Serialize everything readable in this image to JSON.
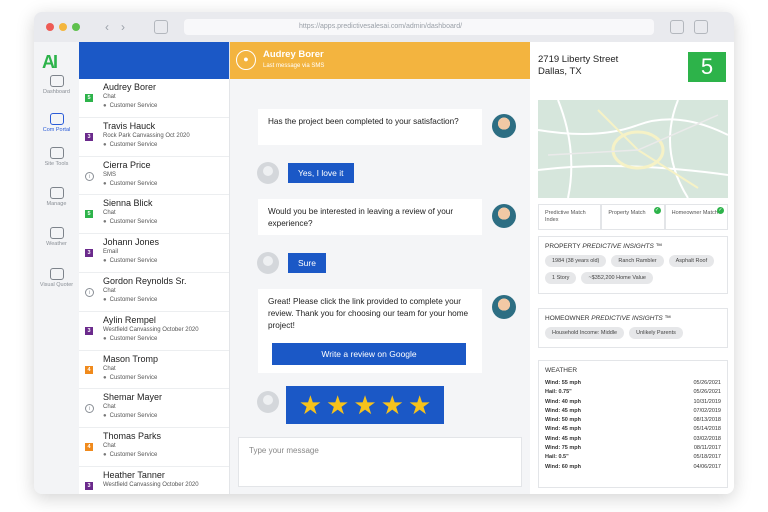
{
  "browser": {
    "url": "https://apps.predictivesalesai.com/admin/dashboard/"
  },
  "logo": {
    "text": "AI"
  },
  "leftnav": [
    {
      "label": "Dashboard",
      "icon": "gauge-icon"
    },
    {
      "label": "Com Portal",
      "icon": "inbox-icon",
      "active": true
    },
    {
      "label": "Site Tools",
      "icon": "checklist-icon"
    },
    {
      "label": "Manage",
      "icon": "ad-icon"
    },
    {
      "label": "Weather",
      "icon": "cloud-rain-icon"
    },
    {
      "label": "Visual Quoter",
      "icon": "video-icon"
    }
  ],
  "contacts": [
    {
      "name": "Audrey Borer",
      "channel": "Chat",
      "category": "Customer Service",
      "badge": "5",
      "badge_color": "#2db34a"
    },
    {
      "name": "Travis Hauck",
      "channel": "Rock Park Canvassing Oct 2020",
      "category": "Customer Service",
      "badge": "3",
      "badge_color": "#6b2a8c"
    },
    {
      "name": "Cierra Price",
      "channel": "SMS",
      "category": "Customer Service",
      "badge": "i",
      "badge_color": "info"
    },
    {
      "name": "Sienna Blick",
      "channel": "Chat",
      "category": "Customer Service",
      "badge": "5",
      "badge_color": "#2db34a"
    },
    {
      "name": "Johann Jones",
      "channel": "Email",
      "category": "Customer Service",
      "badge": "3",
      "badge_color": "#6b2a8c"
    },
    {
      "name": "Gordon Reynolds Sr.",
      "channel": "Chat",
      "category": "Customer Service",
      "badge": "i",
      "badge_color": "info"
    },
    {
      "name": "Aylin Rempel",
      "channel": "Westfield Canvassing October 2020",
      "category": "Customer Service",
      "badge": "3",
      "badge_color": "#6b2a8c"
    },
    {
      "name": "Mason Tromp",
      "channel": "Chat",
      "category": "Customer Service",
      "badge": "4",
      "badge_color": "#f08a1c"
    },
    {
      "name": "Shemar Mayer",
      "channel": "Chat",
      "category": "Customer Service",
      "badge": "i",
      "badge_color": "info"
    },
    {
      "name": "Thomas Parks",
      "channel": "Chat",
      "category": "Customer Service",
      "badge": "4",
      "badge_color": "#f08a1c"
    },
    {
      "name": "Heather Tanner",
      "channel": "Westfield Canvassing October 2020",
      "category": "",
      "badge": "3",
      "badge_color": "#6b2a8c"
    }
  ],
  "chat": {
    "name": "Audrey Borer",
    "subtitle": "Last message via SMS",
    "messages": {
      "q1": "Has the project been completed to your satisfaction?",
      "a1": "Yes, I love it",
      "q2": "Would you be interested in leaving a review of your experience?",
      "a2": "Sure",
      "q3": "Great! Please click the link provided to complete your review. Thank you for choosing our team for your home project!",
      "review_button": "Write a review on Google"
    },
    "rating": 5,
    "input_placeholder": "Type your message"
  },
  "property": {
    "address_line1": "2719 Liberty Street",
    "address_line2": "Dallas, TX",
    "score": "5",
    "matches": [
      {
        "label": "Predictive Match Index",
        "checked": false
      },
      {
        "label": "Property Match",
        "checked": true
      },
      {
        "label": "Homeowner Match",
        "checked": true
      }
    ],
    "insights_title": "PROPERTY",
    "insights_title_italic": "PREDICTIVE INSIGHTS ™",
    "insights": [
      "1984 (38 years old)",
      "Ranch Rambler",
      "Asphalt Roof",
      "1 Story",
      "~$352,200 Home Value"
    ],
    "homeowner_title": "HOMEOWNER",
    "homeowner_title_italic": "PREDICTIVE INSIGHTS ™",
    "homeowner": [
      "Household Income: Middle",
      "Unlikely Parents"
    ],
    "weather_title": "WEATHER",
    "weather": [
      {
        "label": "Wind: 55 mph",
        "date": "05/26/2021"
      },
      {
        "label": "Hail: 0.75\"",
        "date": "05/26/2021"
      },
      {
        "label": "Wind: 40 mph",
        "date": "10/31/2019"
      },
      {
        "label": "Wind: 45 mph",
        "date": "07/02/2019"
      },
      {
        "label": "Wind: 50 mph",
        "date": "08/13/2018"
      },
      {
        "label": "Wind: 45 mph",
        "date": "05/14/2018"
      },
      {
        "label": "Wind: 45 mph",
        "date": "03/02/2018"
      },
      {
        "label": "Wind: 75 mph",
        "date": "08/11/2017"
      },
      {
        "label": "Hail: 0.5\"",
        "date": "05/18/2017"
      },
      {
        "label": "Wind: 60 mph",
        "date": "04/06/2017"
      }
    ]
  },
  "colors": {
    "primary": "#1b58c6",
    "accent": "#f3b43f",
    "success": "#2db34a"
  }
}
